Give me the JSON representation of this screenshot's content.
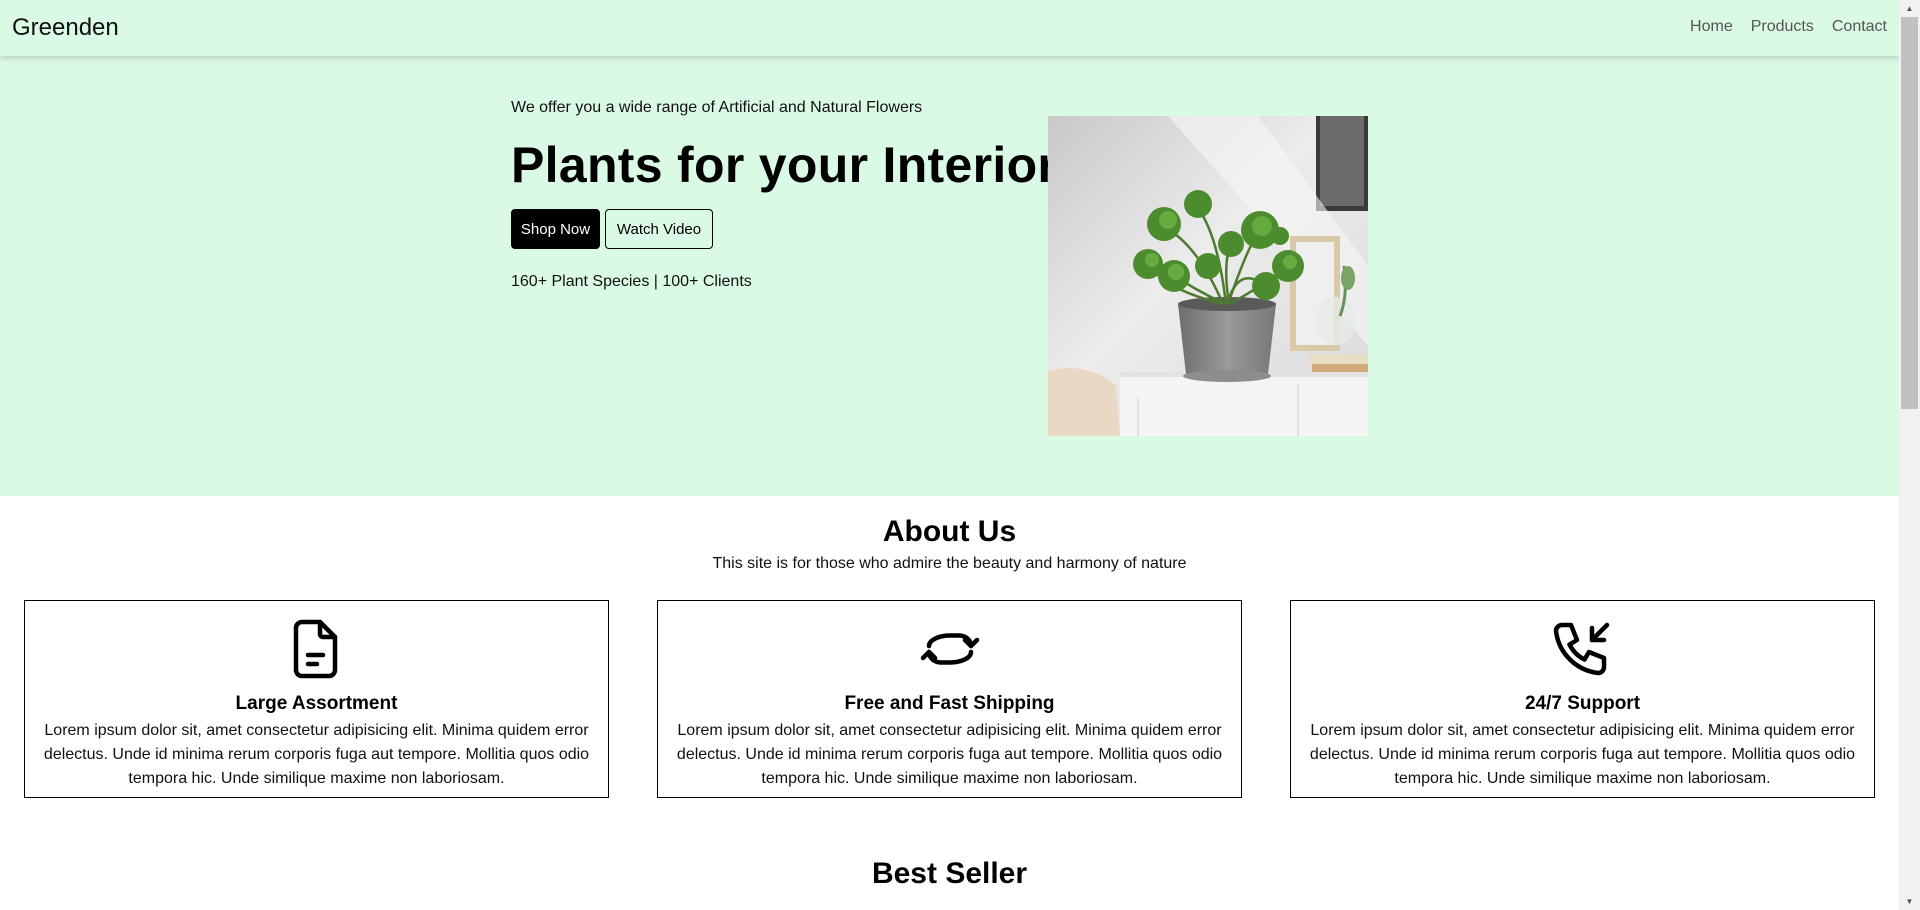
{
  "navbar": {
    "brand": "Greenden",
    "links": [
      "Home",
      "Products",
      "Contact"
    ]
  },
  "hero": {
    "tagline": "We offer you a wide range of Artificial and Natural Flowers",
    "title": "Plants for your Interior",
    "shop_button": "Shop Now",
    "watch_button": "Watch Video",
    "stats": "160+ Plant Species | 100+ Clients",
    "image_subject": "potted pilea plant on white cabinet"
  },
  "about": {
    "title": "About Us",
    "subtitle": "This site is for those who admire the beauty and harmony of nature",
    "cards": [
      {
        "icon": "document-icon",
        "title": "Large Assortment",
        "text": "Lorem ipsum dolor sit, amet consectetur adipisicing elit. Minima quidem error delectus. Unde id minima rerum corporis fuga aut tempore. Mollitia quos odio tempora hic. Unde similique maxime non laboriosam."
      },
      {
        "icon": "refresh-icon",
        "title": "Free and Fast Shipping",
        "text": "Lorem ipsum dolor sit, amet consectetur adipisicing elit. Minima quidem error delectus. Unde id minima rerum corporis fuga aut tempore. Mollitia quos odio tempora hic. Unde similique maxime non laboriosam."
      },
      {
        "icon": "phone-incoming-icon",
        "title": "24/7 Support",
        "text": "Lorem ipsum dolor sit, amet consectetur adipisicing elit. Minima quidem error delectus. Unde id minima rerum corporis fuga aut tempore. Mollitia quos odio tempora hic. Unde similique maxime non laboriosam."
      }
    ]
  },
  "best_seller": {
    "title": "Best Seller"
  },
  "colors": {
    "hero_background": "#dbfae6",
    "primary_button": "#000000"
  }
}
